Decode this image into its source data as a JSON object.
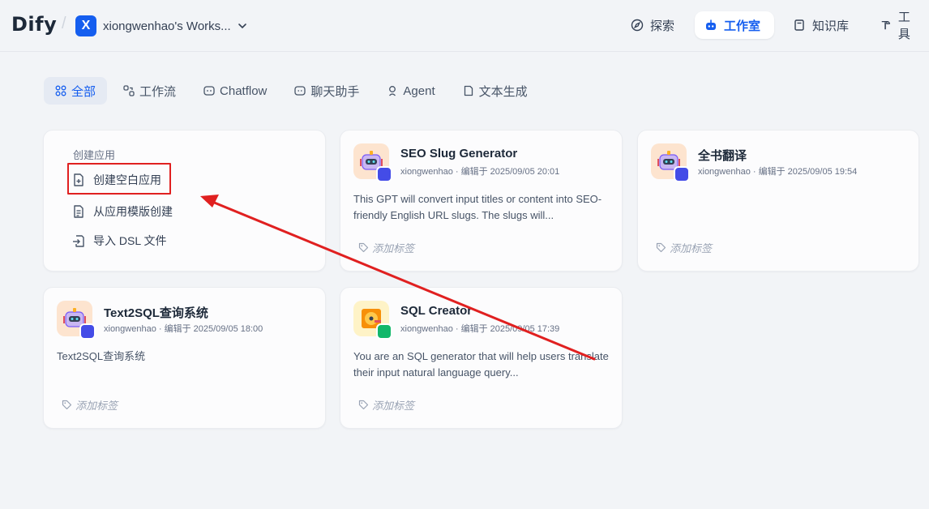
{
  "header": {
    "logo": "Dify",
    "workspace_initial": "X",
    "workspace_name": "xiongwenhao's Works...",
    "nav": [
      {
        "label": "探索",
        "icon": "compass-icon"
      },
      {
        "label": "工作室",
        "icon": "robot-icon",
        "active": true
      },
      {
        "label": "知识库",
        "icon": "book-icon"
      },
      {
        "label": "工具",
        "icon": "hammer-icon"
      }
    ]
  },
  "filters": [
    {
      "label": "全部",
      "icon": "grid-icon",
      "active": true
    },
    {
      "label": "工作流",
      "icon": "workflow-icon"
    },
    {
      "label": "Chatflow",
      "icon": "chatflow-icon"
    },
    {
      "label": "聊天助手",
      "icon": "chat-bot-icon"
    },
    {
      "label": "Agent",
      "icon": "agent-icon"
    },
    {
      "label": "文本生成",
      "icon": "document-icon"
    }
  ],
  "create": {
    "title": "创建应用",
    "items": [
      {
        "label": "创建空白应用",
        "icon": "file-plus-icon"
      },
      {
        "label": "从应用模版创建",
        "icon": "template-icon"
      },
      {
        "label": "导入 DSL 文件",
        "icon": "import-icon"
      }
    ]
  },
  "apps": [
    {
      "name": "SEO Slug Generator",
      "meta": "xiongwenhao · 编辑于 2025/09/05 20:01",
      "desc": "This GPT will convert input titles or content into SEO-friendly English URL slugs. The slugs will...",
      "tag": "添加标签"
    },
    {
      "name": "全书翻译",
      "meta": "xiongwenhao · 编辑于 2025/09/05 19:54",
      "desc": "",
      "tag": "添加标签"
    },
    {
      "name": "Text2SQL查询系统",
      "meta": "xiongwenhao · 编辑于 2025/09/05 18:00",
      "desc": "Text2SQL查询系统",
      "tag": "添加标签"
    },
    {
      "name": "SQL Creator",
      "meta": "xiongwenhao · 编辑于 2025/09/05 17:39",
      "desc": "You are an SQL generator that will help users translate their input natural language query...",
      "tag": "添加标签"
    }
  ],
  "colors": {
    "accent": "#155eef",
    "annotation": "#e02020"
  }
}
